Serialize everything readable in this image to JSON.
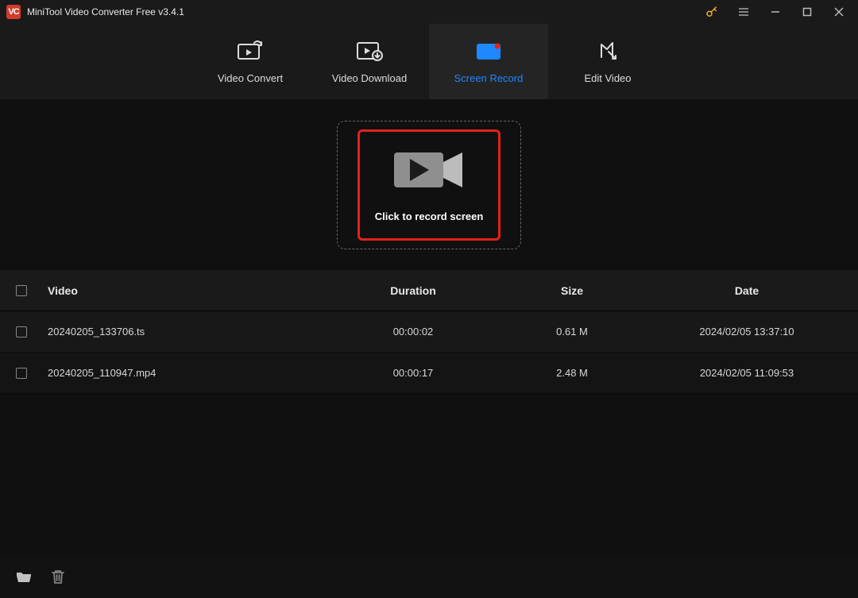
{
  "title": "MiniTool Video Converter Free v3.4.1",
  "appIconText": "VC",
  "tabs": {
    "convert": "Video Convert",
    "download": "Video Download",
    "record": "Screen Record",
    "edit": "Edit Video"
  },
  "record": {
    "label": "Click to record screen"
  },
  "table": {
    "headers": {
      "video": "Video",
      "duration": "Duration",
      "size": "Size",
      "date": "Date"
    },
    "rows": [
      {
        "video": "20240205_133706.ts",
        "duration": "00:00:02",
        "size": "0.61 M",
        "date": "2024/02/05 13:37:10"
      },
      {
        "video": "20240205_110947.mp4",
        "duration": "00:00:17",
        "size": "2.48 M",
        "date": "2024/02/05 11:09:53"
      }
    ]
  }
}
